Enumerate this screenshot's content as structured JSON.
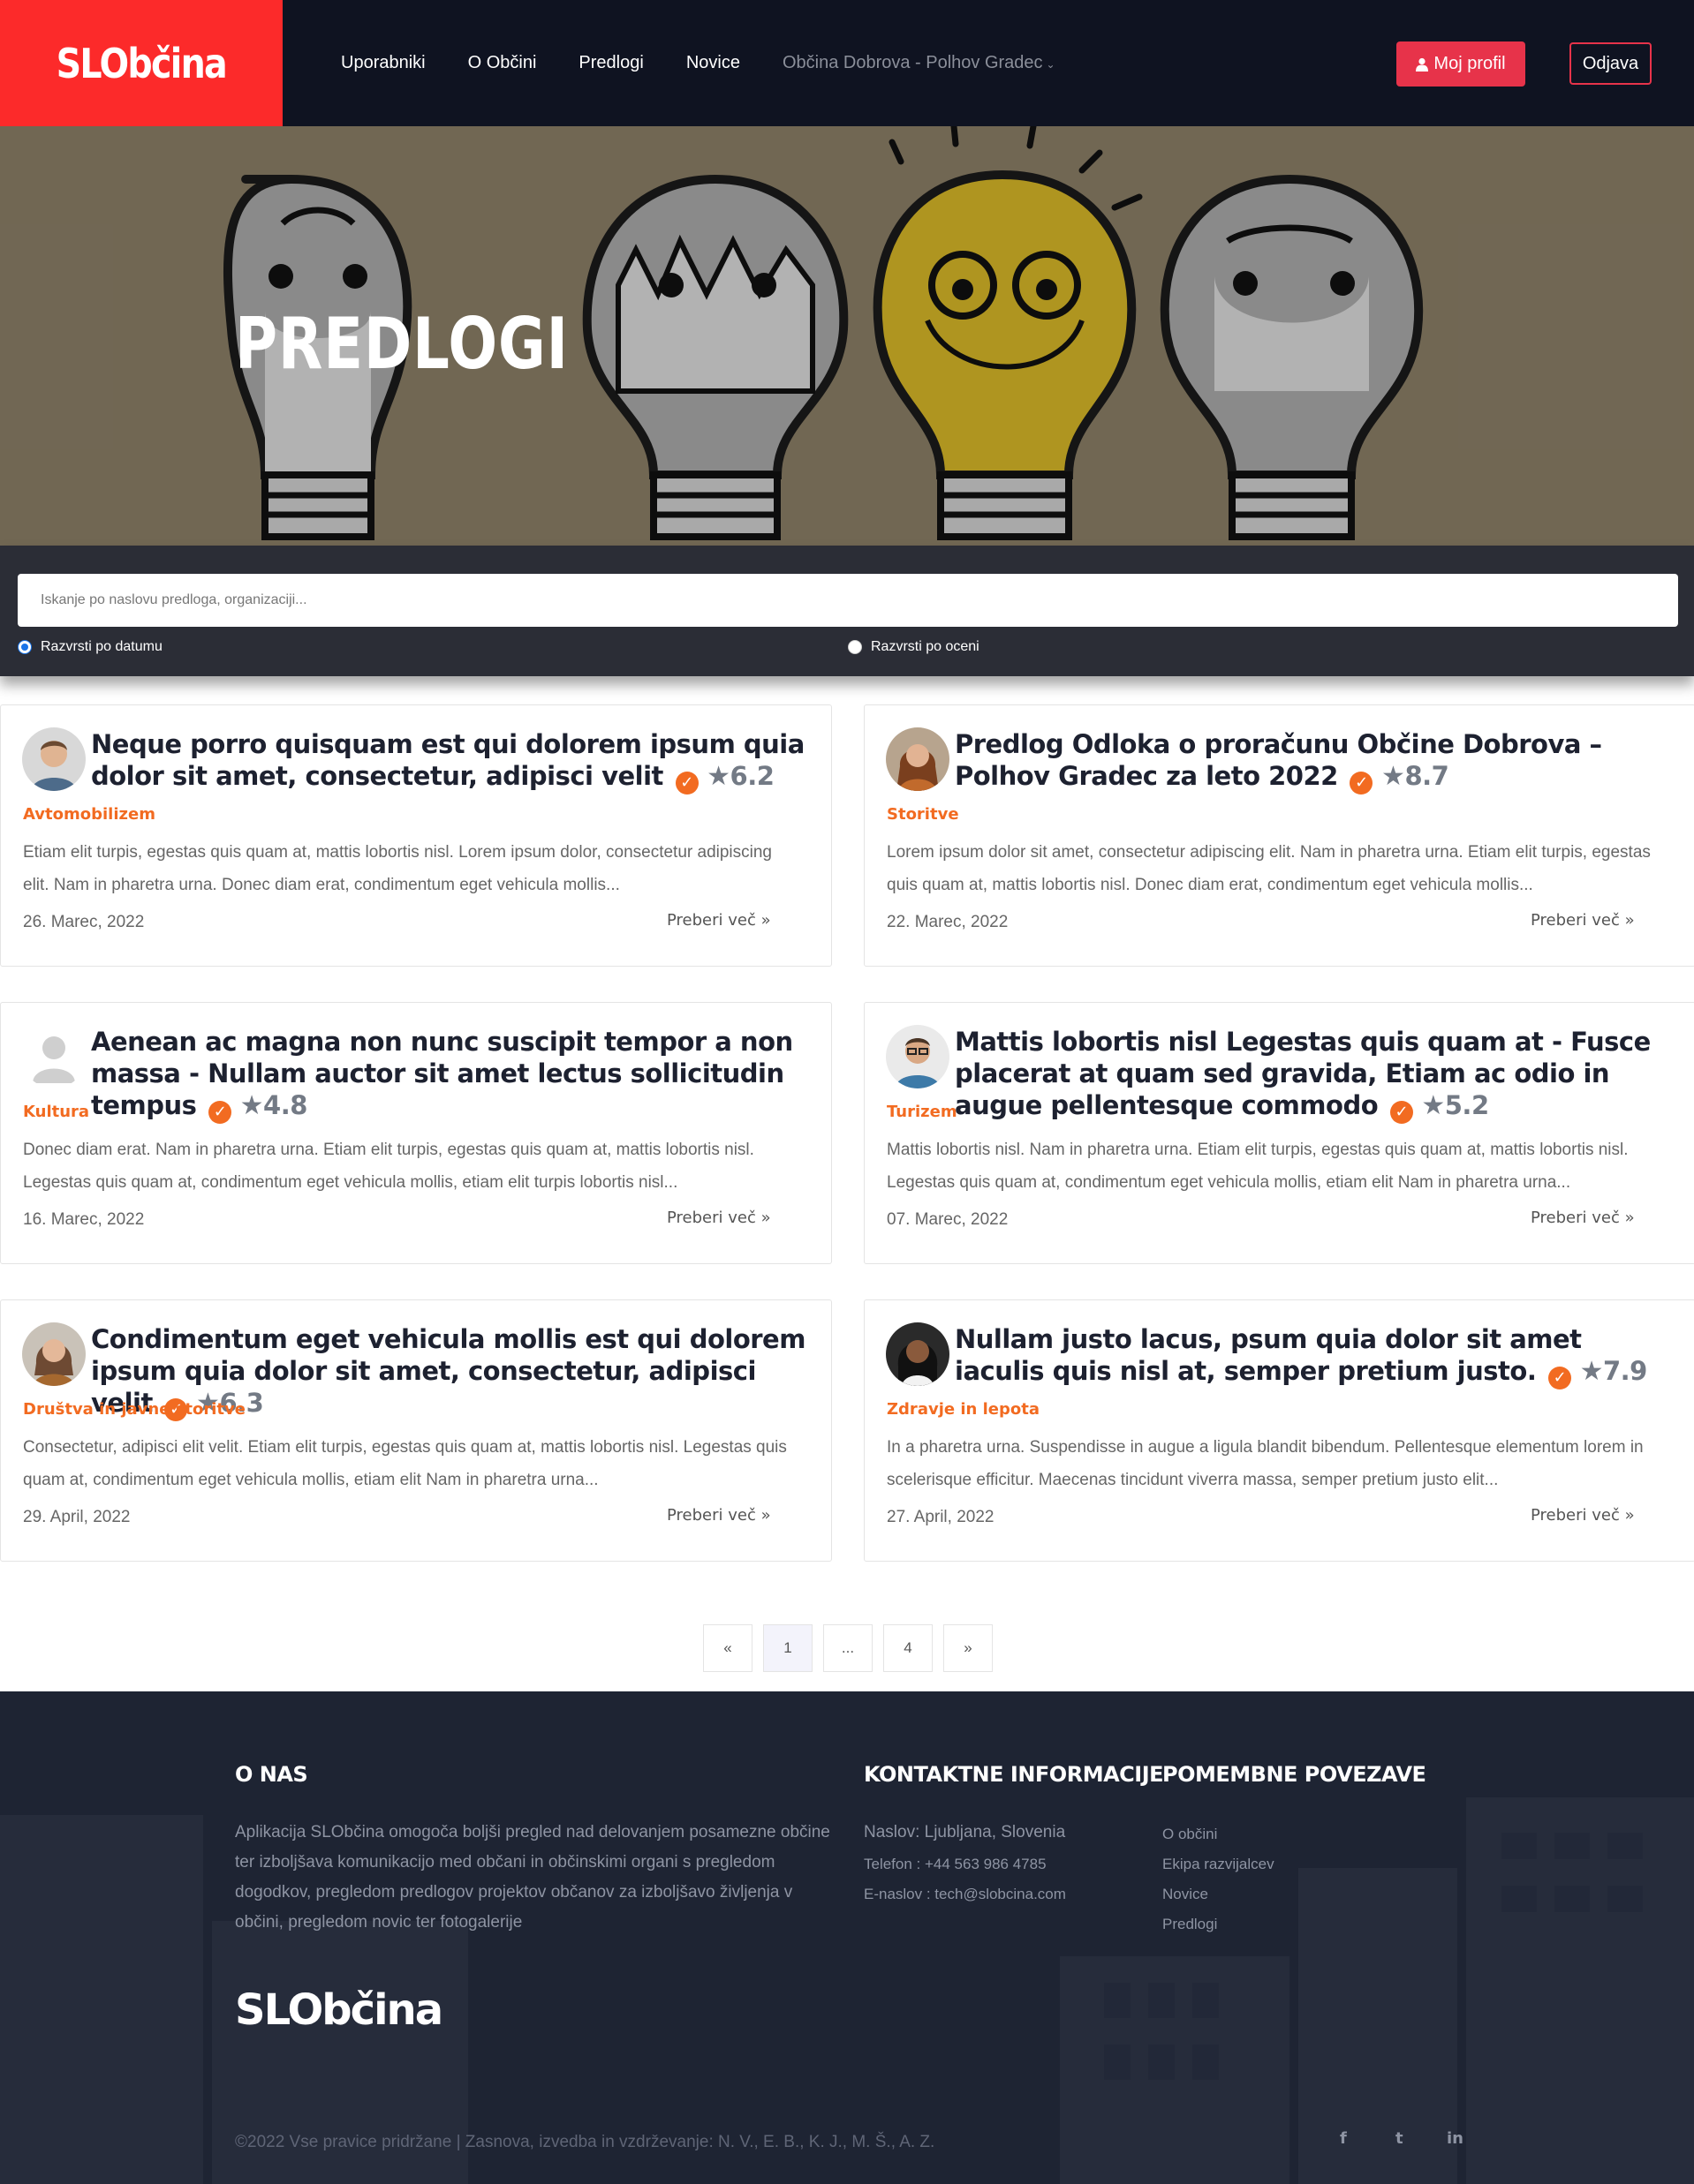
{
  "header": {
    "logo": "SLObčina",
    "nav": [
      "Uporabniki",
      "O Občini",
      "Predlogi",
      "Novice"
    ],
    "municipality": "Občina Dobrova - Polhov Gradec",
    "profile_button": "Moj profil",
    "logout_button": "Odjava"
  },
  "hero": {
    "title": "PREDLOGI"
  },
  "search": {
    "placeholder": "Iskanje po naslovu predloga, organizaciji...",
    "sort_date": "Razvrsti po datumu",
    "sort_rating": "Razvrsti po oceni"
  },
  "cards": [
    {
      "title": "Neque porro quisquam est qui dolorem ipsum quia dolor sit amet, consectetur, adipisci velit",
      "rating": "6.2",
      "category": "Avtomobilizem",
      "excerpt": "Etiam elit turpis, egestas quis quam at, mattis lobortis nisl. Lorem ipsum dolor, consectetur adipiscing elit. Nam in pharetra urna. Donec diam erat, condimentum eget vehicula mollis...",
      "date": "26. Marec, 2022",
      "read_more": "Preberi več"
    },
    {
      "title": "Predlog Odloka o proračunu Občine Dobrova – Polhov Gradec za leto 2022",
      "rating": "8.7",
      "category": "Storitve",
      "excerpt": "Lorem ipsum dolor sit amet, consectetur adipiscing elit. Nam in pharetra urna. Etiam elit turpis, egestas quis quam at, mattis lobortis nisl. Donec diam erat, condimentum eget vehicula mollis...",
      "date": "22. Marec, 2022",
      "read_more": "Preberi več"
    },
    {
      "title": "Aenean ac magna non nunc suscipit tempor a non massa - Nullam auctor sit amet lectus sollicitudin tempus",
      "rating": "4.8",
      "category": "Kultura",
      "excerpt": "Donec diam erat. Nam in pharetra urna. Etiam elit turpis, egestas quis quam at, mattis lobortis nisl. Legestas quis quam at, condimentum eget vehicula mollis, etiam elit turpis lobortis nisl...",
      "date": "16. Marec, 2022",
      "read_more": "Preberi več"
    },
    {
      "title": "Mattis lobortis nisl Legestas quis quam at - Fusce placerat at quam sed gravida, Etiam ac odio in augue pellentesque commodo",
      "rating": "5.2",
      "category": "Turizem",
      "excerpt": "Mattis lobortis nisl. Nam in pharetra urna. Etiam elit turpis, egestas quis quam at, mattis lobortis nisl. Legestas quis quam at, condimentum eget vehicula mollis, etiam elit Nam in pharetra urna...",
      "date": "07. Marec, 2022",
      "read_more": "Preberi več"
    },
    {
      "title": "Condimentum eget vehicula mollis est qui dolorem ipsum quia dolor sit amet, consectetur, adipisci velit",
      "rating": "6.3",
      "category": "Društva in javne storitve",
      "excerpt": "Consectetur, adipisci elit velit. Etiam elit turpis, egestas quis quam at, mattis lobortis nisl. Legestas quis quam at, condimentum eget vehicula mollis, etiam elit Nam in pharetra urna...",
      "date": "29. April, 2022",
      "read_more": "Preberi več"
    },
    {
      "title": "Nullam justo lacus, psum quia dolor sit amet iaculis quis nisl at, semper pretium justo.",
      "rating": "7.9",
      "category": "Zdravje in lepota",
      "excerpt": "In a pharetra urna. Suspendisse in augue a ligula blandit bibendum. Pellentesque elementum lorem in scelerisque efficitur. Maecenas tincidunt viverra massa, semper pretium justo elit...",
      "date": "27. April, 2022",
      "read_more": "Preberi več"
    }
  ],
  "pagination": {
    "prev": "«",
    "current": "1",
    "ellipsis": "...",
    "last": "4",
    "next": "»"
  },
  "footer": {
    "about_heading": "O NAS",
    "about_text": "Aplikacija SLObčina omogoča boljši pregled nad delovanjem posamezne občine ter izboljšava komunikacijo med občani in občinskimi organi s pregledom dogodkov, pregledom predlogov projektov občanov za izboljšavo življenja v občini, pregledom novic ter fotogalerije",
    "contact_heading": "KONTAKTNE INFORMACIJE",
    "address": "Naslov: Ljubljana, Slovenia",
    "phone": "Telefon : +44 563 986 4785",
    "email": "E-naslov : tech@slobcina.com",
    "links_heading": "POMEMBNE POVEZAVE",
    "links": [
      "O občini",
      "Ekipa razvijalcev",
      "Novice",
      "Predlogi"
    ],
    "logo": "SLObčina",
    "copyright": "©2022 Vse pravice pridržane | Zasnova, izvedba in vzdrževanje: N. V., E. B., K. J., M. Š., A. Z.",
    "social": [
      "f",
      "t",
      "in"
    ]
  },
  "colors": {
    "brand_red": "#fc2a2a",
    "accent_orange": "#f26b21",
    "header_bg": "#0f1321",
    "footer_bg": "#1e2433",
    "button_red": "#e7334a"
  }
}
